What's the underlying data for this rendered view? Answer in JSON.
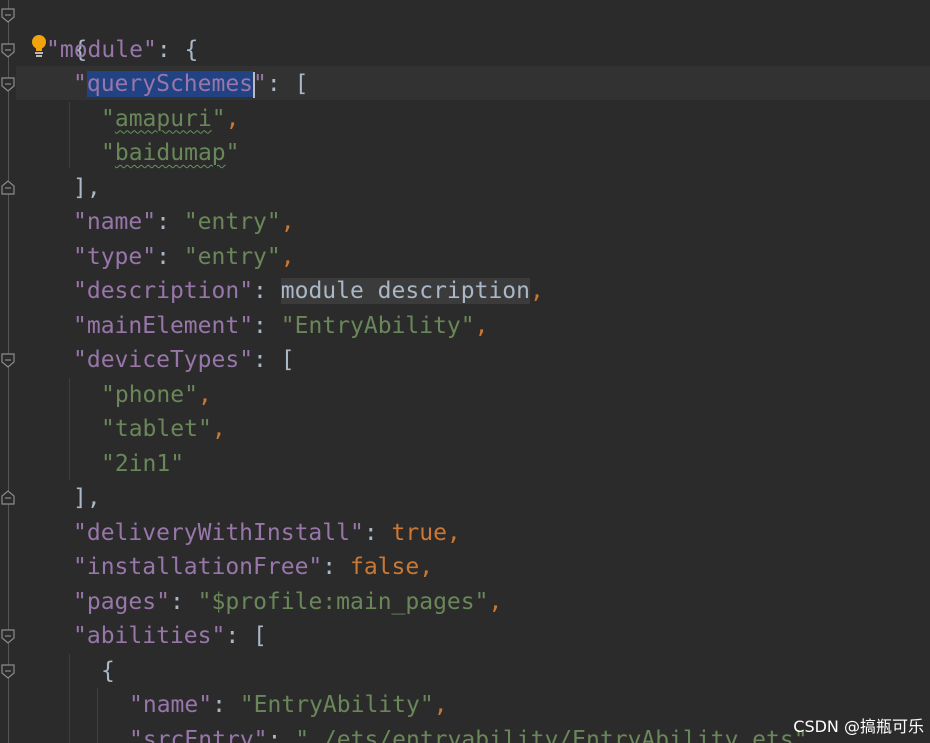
{
  "editor": {
    "lines": [
      {
        "open": "{"
      },
      {
        "key": "module",
        "colon": ": ",
        "open": "{"
      },
      {
        "key": "querySchemes",
        "colon": ": ",
        "open": "["
      },
      {
        "value": "amapuri",
        "comma": ","
      },
      {
        "value": "baidumap"
      },
      {
        "close": "],"
      },
      {
        "key": "name",
        "colon": ": ",
        "value": "entry",
        "comma": ","
      },
      {
        "key": "type",
        "colon": ": ",
        "value": "entry",
        "comma": ","
      },
      {
        "key": "description",
        "colon": ": ",
        "hint": "module description",
        "comma": ","
      },
      {
        "key": "mainElement",
        "colon": ": ",
        "value": "EntryAbility",
        "comma": ","
      },
      {
        "key": "deviceTypes",
        "colon": ": ",
        "open": "["
      },
      {
        "value": "phone",
        "comma": ","
      },
      {
        "value": "tablet",
        "comma": ","
      },
      {
        "value": "2in1"
      },
      {
        "close": "],"
      },
      {
        "key": "deliveryWithInstall",
        "colon": ": ",
        "literal": "true",
        "comma": ","
      },
      {
        "key": "installationFree",
        "colon": ": ",
        "literal": "false",
        "comma": ","
      },
      {
        "key": "pages",
        "colon": ": ",
        "value": "$profile:main_pages",
        "comma": ","
      },
      {
        "key": "abilities",
        "colon": ": ",
        "open": "["
      },
      {
        "open": "{"
      },
      {
        "key": "name",
        "colon": ": ",
        "value": "EntryAbility",
        "comma": ","
      },
      {
        "key": "srcEntry",
        "colon": ": ",
        "value": "./ets/entryability/EntryAbility.ets",
        "comma": ","
      }
    ],
    "quote": "\""
  },
  "watermark": "CSDN @搞瓶可乐",
  "colors": {
    "background": "#2b2b2b",
    "key": "#9876aa",
    "string": "#6a8759",
    "keyword": "#cc7832",
    "punctuation": "#a9b7c6",
    "selection": "#214283"
  }
}
